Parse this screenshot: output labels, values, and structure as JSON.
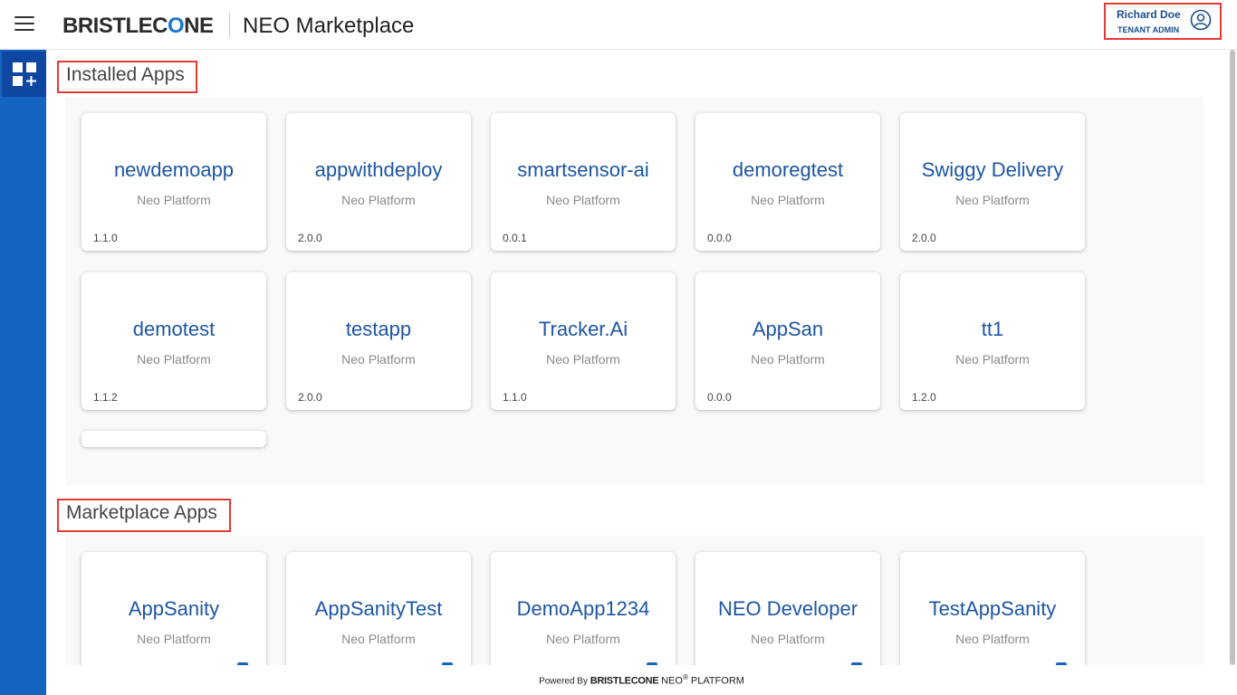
{
  "header": {
    "logo_text": "BRISTLECONE",
    "app_title": "NEO Marketplace",
    "user_name": "Richard Doe",
    "user_role": "TENANT ADMIN"
  },
  "sidebar": {
    "items": [
      {
        "icon": "apps-add-icon"
      }
    ]
  },
  "installed": {
    "label": "Installed Apps",
    "cards": [
      {
        "name": "newdemoapp",
        "publisher": "Neo Platform",
        "version": "1.1.0"
      },
      {
        "name": "appwithdeploy",
        "publisher": "Neo Platform",
        "version": "2.0.0"
      },
      {
        "name": "smartsensor-ai",
        "publisher": "Neo Platform",
        "version": "0.0.1"
      },
      {
        "name": "demoregtest",
        "publisher": "Neo Platform",
        "version": "0.0.0"
      },
      {
        "name": "Swiggy Delivery",
        "publisher": "Neo Platform",
        "version": "2.0.0"
      },
      {
        "name": "demotest",
        "publisher": "Neo Platform",
        "version": "1.1.2"
      },
      {
        "name": "testapp",
        "publisher": "Neo Platform",
        "version": "2.0.0"
      },
      {
        "name": "Tracker.Ai",
        "publisher": "Neo Platform",
        "version": "1.1.0"
      },
      {
        "name": "AppSan",
        "publisher": "Neo Platform",
        "version": "0.0.0"
      },
      {
        "name": "tt1",
        "publisher": "Neo Platform",
        "version": "1.2.0"
      }
    ]
  },
  "marketplace": {
    "label": "Marketplace Apps",
    "cards": [
      {
        "name": "AppSanity",
        "publisher": "Neo Platform"
      },
      {
        "name": "AppSanityTest",
        "publisher": "Neo Platform"
      },
      {
        "name": "DemoApp1234",
        "publisher": "Neo Platform"
      },
      {
        "name": "NEO Developer",
        "publisher": "Neo Platform"
      },
      {
        "name": "TestAppSanity",
        "publisher": "Neo Platform"
      }
    ]
  },
  "footer": {
    "powered_by": "Powered By",
    "brand": "BRISTLECONE",
    "product": "NEO",
    "reg": "®",
    "platform": "PLATFORM"
  },
  "colors": {
    "brand_blue": "#1565c0",
    "highlight_red": "#e53935",
    "card_title": "#1d56a3"
  }
}
